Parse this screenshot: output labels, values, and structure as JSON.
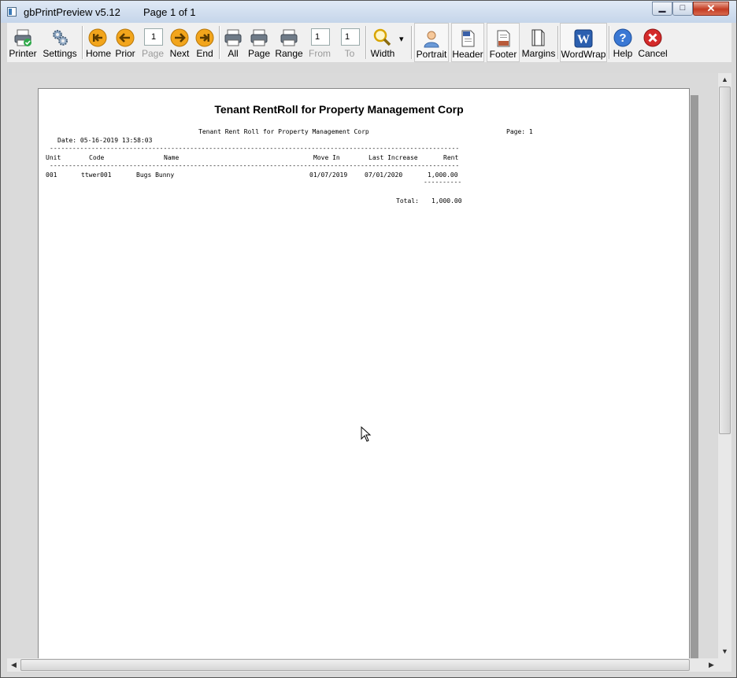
{
  "window": {
    "app_name": "gbPrintPreview",
    "version": "v5.12",
    "page_info": "Page 1 of  1",
    "min_glyph": "▁",
    "max_glyph": "□",
    "close_glyph": "✕"
  },
  "toolbar": {
    "printer": "Printer",
    "settings": "Settings",
    "home": "Home",
    "prior": "Prior",
    "page_value": "1",
    "page_label": "Page",
    "next": "Next",
    "end": "End",
    "all": "All",
    "page": "Page",
    "range": "Range",
    "from_value": "1",
    "from_label": "From",
    "to_value": "1",
    "to_label": "To",
    "width": "Width",
    "dropdown_glyph": "▾",
    "portrait": "Portrait",
    "header": "Header",
    "footer": "Footer",
    "margins": "Margins",
    "wordwrap": "WordWrap",
    "help": "Help",
    "cancel": "Cancel"
  },
  "icons": {
    "printer": "printer-icon",
    "settings": "gears-icon",
    "home": "first-page-icon",
    "prior": "prev-arrow-icon",
    "next": "next-arrow-icon",
    "end": "last-page-icon",
    "width": "magnifier-icon",
    "portrait": "person-icon",
    "header": "page-header-icon",
    "footer": "page-footer-icon",
    "margins": "margins-icon",
    "wordwrap": "word-icon",
    "help": "help-icon",
    "cancel": "cancel-icon"
  },
  "report": {
    "title": "Tenant RentRoll for Property Management Corp",
    "header_title": "Tenant Rent Roll for Property Management Corp",
    "page_label": "Page: 1",
    "date_line": "Date: 05-16-2019 13:58:03",
    "dashes": "------------------------------------------------------------------------------------------------------------",
    "columns": {
      "unit": "Unit",
      "code": "Code",
      "name": "Name",
      "move_in": "Move In",
      "last_increase": "Last Increase",
      "rent": "Rent"
    },
    "rows": [
      {
        "unit": "001",
        "code": "ttwer001",
        "name": "Bugs Bunny",
        "move_in": "01/07/2019",
        "last_increase": "07/01/2020",
        "rent": "1,000.00"
      }
    ],
    "subtotal_line": "----------",
    "total_label": "Total:",
    "total_value": "1,000.00"
  },
  "colors": {
    "accent": "#3b7ab8",
    "nav_orange": "#f2a51c",
    "cancel_red": "#d42a2a",
    "help_blue": "#3a78d4",
    "check_green": "#2fa94a"
  }
}
